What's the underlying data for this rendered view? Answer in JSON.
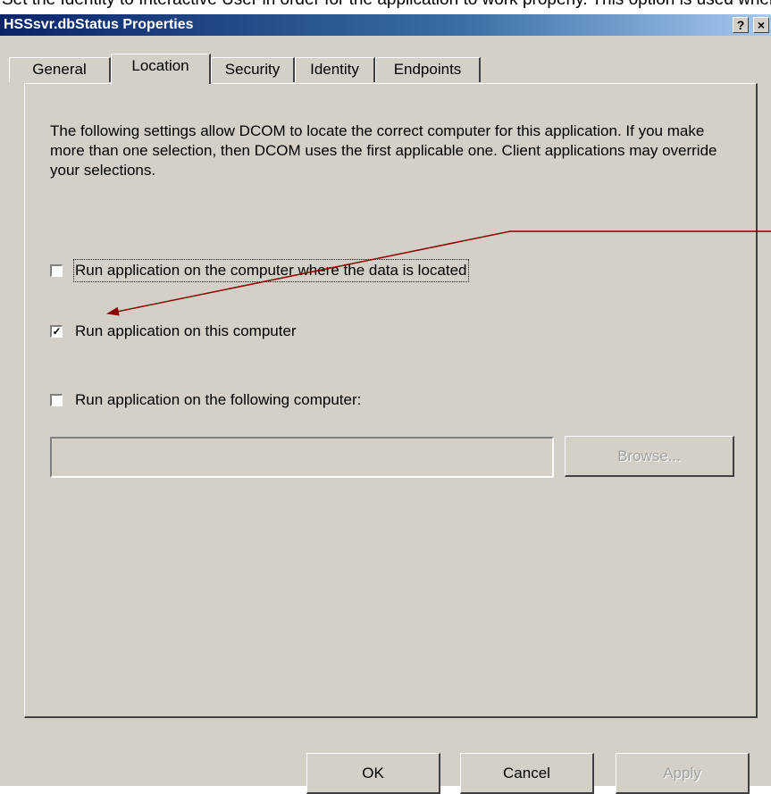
{
  "doc_fragment": "Set the Identity to Interactive User in order for the application to work properly. This option is used when the user is logged on.",
  "window": {
    "title": "HSSsvr.dbStatus Properties",
    "help_label": "?",
    "close_label": "×"
  },
  "tabs": [
    {
      "label": "General"
    },
    {
      "label": "Location"
    },
    {
      "label": "Security"
    },
    {
      "label": "Identity"
    },
    {
      "label": "Endpoints"
    }
  ],
  "active_tab": "Location",
  "location": {
    "description": "The following settings allow DCOM to locate the correct computer for this application.  If you make more than one selection, then DCOM uses the first applicable one.  Client applications may override your selections.",
    "options": [
      {
        "label": "Run application on the computer where the data is located",
        "checked": false,
        "check_glyph": ""
      },
      {
        "label": "Run application on this computer",
        "checked": true,
        "check_glyph": "✓"
      },
      {
        "label": "Run application on the following computer:",
        "checked": false,
        "check_glyph": ""
      }
    ],
    "computer_value": "",
    "browse_label": "Browse..."
  },
  "buttons": {
    "ok": "OK",
    "cancel": "Cancel",
    "apply": "Apply"
  },
  "annotation_color": "#8b0000"
}
